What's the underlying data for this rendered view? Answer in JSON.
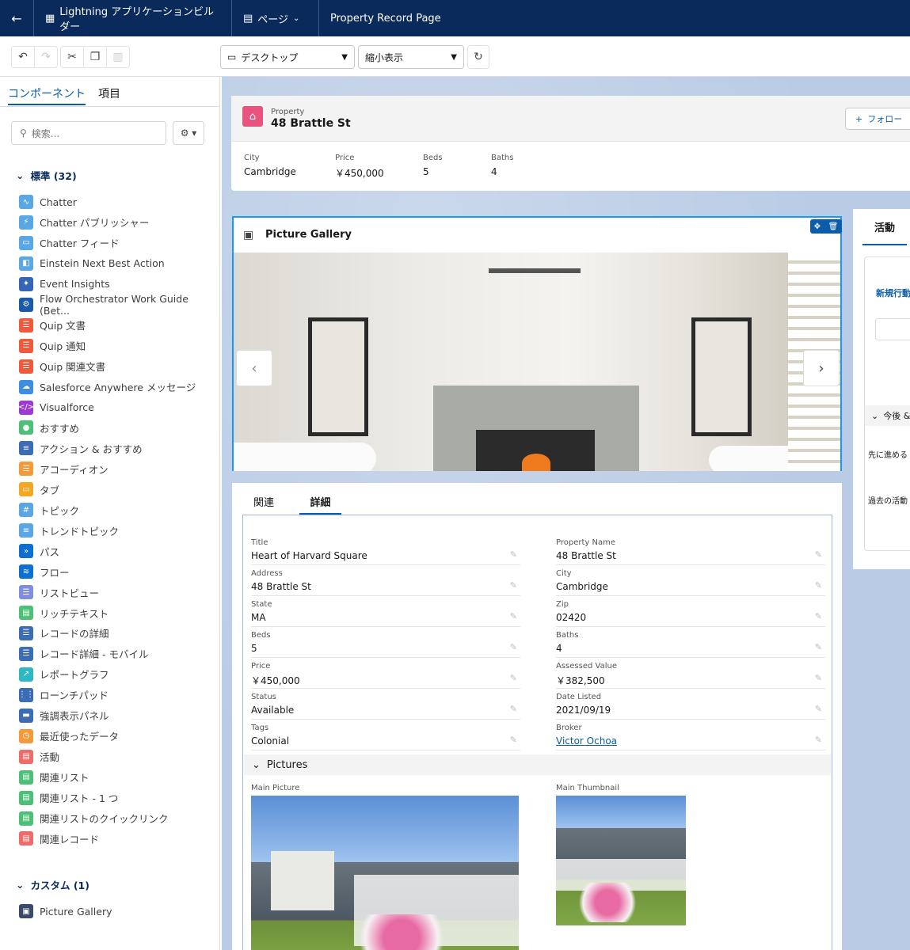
{
  "header": {
    "app_title": "Lightning アプリケーションビルダー",
    "pages_label": "ページ",
    "record_page": "Property Record Page"
  },
  "toolbar": {
    "device": "デスクトップ",
    "view": "縮小表示"
  },
  "sidebar": {
    "tab_components": "コンポーネント",
    "tab_fields": "項目",
    "search_placeholder": "検索...",
    "standard_heading": "標準 (32)",
    "custom_heading": "カスタム (1)",
    "standard_items": [
      {
        "label": "Chatter",
        "color": "#5aa7e4",
        "glyph": "∿"
      },
      {
        "label": "Chatter パブリッシャー",
        "color": "#5aa7e4",
        "glyph": "⚡"
      },
      {
        "label": "Chatter フィード",
        "color": "#5aa7e4",
        "glyph": "▭"
      },
      {
        "label": "Einstein Next Best Action",
        "color": "#5aa7e4",
        "glyph": "◧"
      },
      {
        "label": "Event Insights",
        "color": "#3366b5",
        "glyph": "✦"
      },
      {
        "label": "Flow Orchestrator Work Guide (Bet...",
        "color": "#1a5ba8",
        "glyph": "⚙"
      },
      {
        "label": "Quip 文書",
        "color": "#f05a3a",
        "glyph": "☰"
      },
      {
        "label": "Quip 通知",
        "color": "#f05a3a",
        "glyph": "☰"
      },
      {
        "label": "Quip 関連文書",
        "color": "#f05a3a",
        "glyph": "☰"
      },
      {
        "label": "Salesforce Anywhere メッセージ",
        "color": "#3e8ee0",
        "glyph": "☁"
      },
      {
        "label": "Visualforce",
        "color": "#9b3bd1",
        "glyph": "</>"
      },
      {
        "label": "おすすめ",
        "color": "#4bc076",
        "glyph": "●"
      },
      {
        "label": "アクション & おすすめ",
        "color": "#3b6cb4",
        "glyph": "≡"
      },
      {
        "label": "アコーディオン",
        "color": "#f49a3a",
        "glyph": "☰"
      },
      {
        "label": "タブ",
        "color": "#f5a623",
        "glyph": "▭"
      },
      {
        "label": "トピック",
        "color": "#5aa7e4",
        "glyph": "#"
      },
      {
        "label": "トレンドトピック",
        "color": "#5aa7e4",
        "glyph": "≡"
      },
      {
        "label": "パス",
        "color": "#0d6fd4",
        "glyph": "»"
      },
      {
        "label": "フロー",
        "color": "#0d6fd4",
        "glyph": "≋"
      },
      {
        "label": "リストビュー",
        "color": "#7f8de1",
        "glyph": "☰"
      },
      {
        "label": "リッチテキスト",
        "color": "#4bc076",
        "glyph": "▤"
      },
      {
        "label": "レコードの詳細",
        "color": "#3b6cb4",
        "glyph": "☰"
      },
      {
        "label": "レコード詳細 - モバイル",
        "color": "#3b6cb4",
        "glyph": "☰"
      },
      {
        "label": "レポートグラフ",
        "color": "#2eb8c4",
        "glyph": "↗"
      },
      {
        "label": "ローンチパッド",
        "color": "#3b6cb4",
        "glyph": "⋮⋮"
      },
      {
        "label": "強調表示パネル",
        "color": "#3b6cb4",
        "glyph": "▬"
      },
      {
        "label": "最近使ったデータ",
        "color": "#f49a3a",
        "glyph": "◷"
      },
      {
        "label": "活動",
        "color": "#f06a6a",
        "glyph": "▤"
      },
      {
        "label": "関連リスト",
        "color": "#4bc076",
        "glyph": "▤"
      },
      {
        "label": "関連リスト - 1 つ",
        "color": "#4bc076",
        "glyph": "▤"
      },
      {
        "label": "関連リストのクイックリンク",
        "color": "#4bc076",
        "glyph": "▤"
      },
      {
        "label": "関連レコード",
        "color": "#f06a6a",
        "glyph": "▤"
      }
    ],
    "custom_items": [
      {
        "label": "Picture Gallery",
        "color": "#3b4a6b",
        "glyph": "▣"
      }
    ]
  },
  "record": {
    "object": "Property",
    "name": "48 Brattle St",
    "follow": "フォロー",
    "highlights": [
      {
        "label": "City",
        "value": "Cambridge"
      },
      {
        "label": "Price",
        "value": "￥450,000"
      },
      {
        "label": "Beds",
        "value": "5"
      },
      {
        "label": "Baths",
        "value": "4"
      }
    ]
  },
  "gallery": {
    "title": "Picture Gallery"
  },
  "tabs": {
    "related": "関連",
    "details": "詳細"
  },
  "details": {
    "left": [
      {
        "label": "Title",
        "value": "Heart of Harvard Square"
      },
      {
        "label": "Address",
        "value": "48 Brattle St"
      },
      {
        "label": "State",
        "value": "MA"
      },
      {
        "label": "Beds",
        "value": "5"
      },
      {
        "label": "Price",
        "value": "￥450,000"
      },
      {
        "label": "Status",
        "value": "Available"
      },
      {
        "label": "Tags",
        "value": "Colonial"
      }
    ],
    "right": [
      {
        "label": "Property Name",
        "value": "48 Brattle St"
      },
      {
        "label": "City",
        "value": "Cambridge"
      },
      {
        "label": "Zip",
        "value": "02420"
      },
      {
        "label": "Baths",
        "value": "4"
      },
      {
        "label": "Assessed Value",
        "value": "￥382,500"
      },
      {
        "label": "Date Listed",
        "value": "2021/09/19"
      },
      {
        "label": "Broker",
        "value": "Victor Ochoa"
      }
    ],
    "pictures_section": "Pictures",
    "main_picture": "Main Picture",
    "main_thumbnail": "Main Thumbnail"
  },
  "activity": {
    "tab": "活動",
    "new_action": "新規行動",
    "upcoming": "今後 &",
    "next_steps": "先に進める",
    "past": "過去の活動"
  }
}
